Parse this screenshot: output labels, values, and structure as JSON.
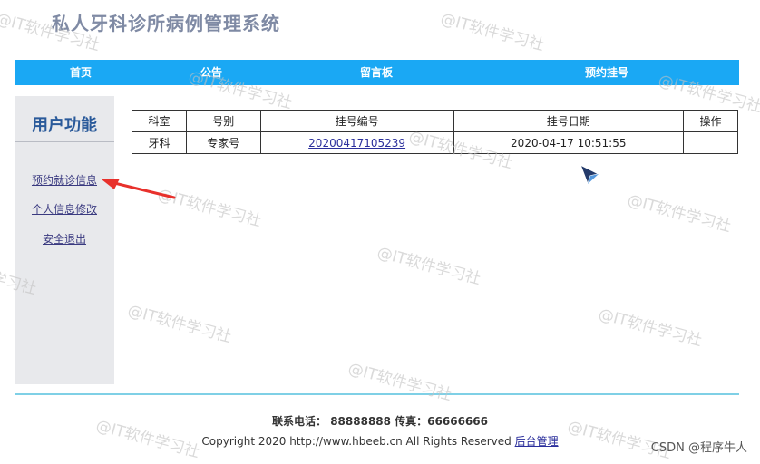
{
  "site": {
    "title": "私人牙科诊所病例管理系统"
  },
  "nav": {
    "items": [
      "首页",
      "公告",
      "留言板",
      "预约挂号"
    ]
  },
  "sidebar": {
    "title": "用户功能",
    "links": [
      "预约就诊信息",
      "个人信息修改",
      "安全退出"
    ]
  },
  "table": {
    "headers": [
      "科室",
      "号别",
      "挂号编号",
      "挂号日期",
      "操作"
    ],
    "rows": [
      {
        "dept": "牙科",
        "type": "专家号",
        "reg_no": "20200417105239",
        "date": "2020-04-17 10:51:55",
        "action": ""
      }
    ]
  },
  "footer": {
    "contact": "联系电话： 88888888 传真：66666666",
    "copyright": "Copyright 2020 http://www.hbeeb.cn All Rights Reserved",
    "admin_link": "后台管理"
  },
  "watermark": {
    "text": "@IT软件学习社",
    "credit": "CSDN @程序牛人"
  },
  "colors": {
    "nav_bg": "#1aa8f4",
    "sidebar_bg": "#e8e9ec",
    "title": "#7f8aa4",
    "footer_line": "#7fd0e6"
  }
}
